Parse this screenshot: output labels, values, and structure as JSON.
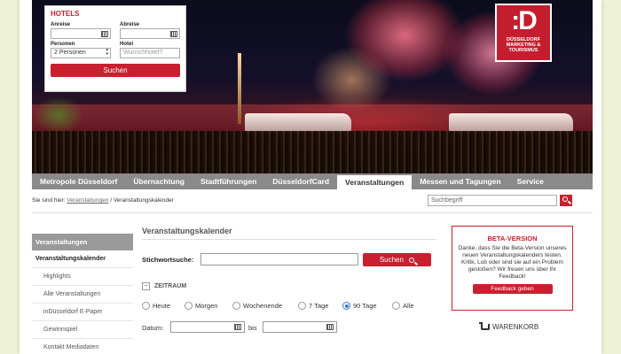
{
  "hotels": {
    "title": "HOTELS",
    "arrival_label": "Anreise",
    "departure_label": "Abreise",
    "persons_label": "Personen",
    "persons_value": "2 Personen",
    "hotel_label": "Hotel",
    "hotel_placeholder": "Wunschhotel?",
    "search_label": "Suchen"
  },
  "logo": {
    "text": [
      "DÜSSELDORF",
      "MARKETING &",
      "TOURISMUS"
    ],
    "color": "#c41e2e"
  },
  "nav": {
    "items": [
      "Metropole Düsseldorf",
      "Übernachtung",
      "Stadtführungen",
      "DüsseldorfCard",
      "Veranstaltungen",
      "Messen und Tagungen",
      "Service"
    ],
    "active_index": 4
  },
  "breadcrumb": {
    "prefix": "Sie sind hier:",
    "link": "Veranstaltungen",
    "separator": "/",
    "current": "Veranstaltungskalender"
  },
  "top_search": {
    "placeholder": "Suchbegriff"
  },
  "sidebar": {
    "head": "Veranstaltungen",
    "items": [
      {
        "label": "Veranstaltungskalender",
        "bold": true
      },
      {
        "label": "Highlights"
      },
      {
        "label": "Alle Veranstaltungen"
      },
      {
        "label": "inDüsseldorf E-Paper"
      },
      {
        "label": "Gewinnspiel"
      },
      {
        "label": "Kontakt Mediadaten"
      }
    ]
  },
  "main": {
    "title": "Veranstaltungskalender",
    "keyword_label": "Stichwortsuche:",
    "keyword_button": "Suchen",
    "zeitraum_toggle": "–",
    "zeitraum_label": "ZEITRAUM",
    "radios": [
      "Heute",
      "Morgen",
      "Wochenende",
      "7 Tage",
      "90 Tage",
      "Alle"
    ],
    "radio_selected": 4,
    "datum_label": "Datum:",
    "bis_label": "bis"
  },
  "beta": {
    "title": "BETA-VERSION",
    "body": "Danke, dass Sie die Beta-Version unseres neuen Veranstaltungskalenders testen. Kritik, Lob oder sind sie auf ein Problem gestoßen? Wir freuen uns über Ihr Feedback!",
    "button": "Feedback geben"
  },
  "cart": {
    "label": "WARENKORB"
  },
  "colors": {
    "accent": "#c8202f",
    "nav_bg": "#8a8a8a",
    "radio_on": "#3a7bd5"
  }
}
